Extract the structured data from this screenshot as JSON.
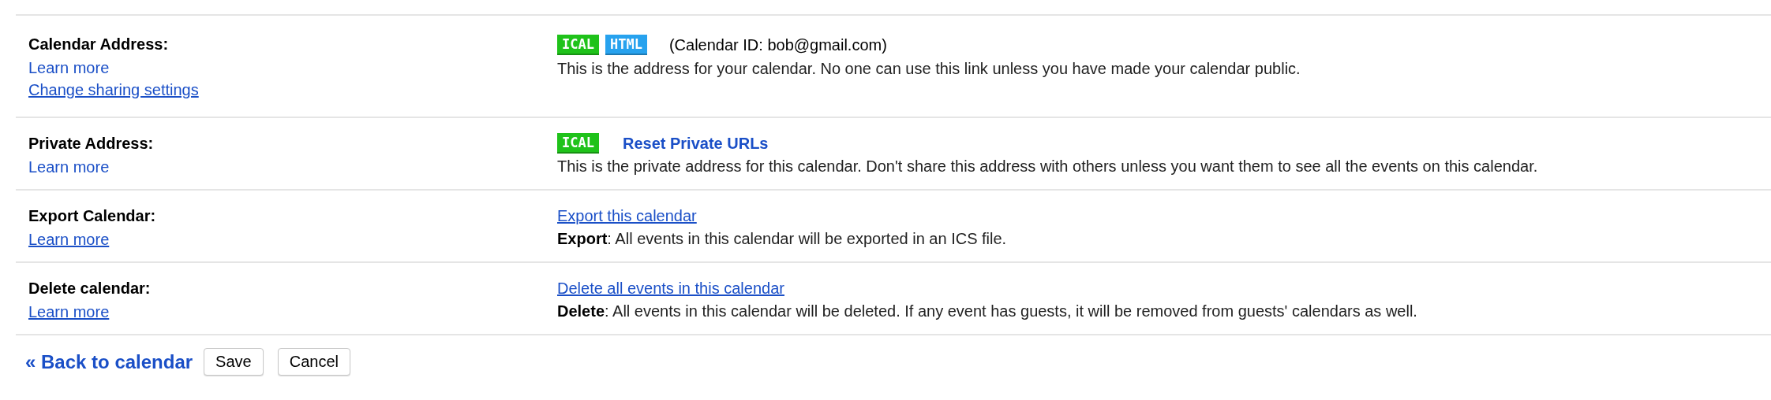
{
  "rows": [
    {
      "label": "Calendar Address:",
      "links": [
        {
          "text": "Learn more",
          "underlined": false
        },
        {
          "text": "Change sharing settings",
          "underlined": true
        }
      ],
      "controls": [
        {
          "kind": "badge",
          "text": "ICAL",
          "color": "#1fc21a"
        },
        {
          "kind": "badge",
          "text": "HTML",
          "color": "#27a2ee"
        },
        {
          "kind": "text",
          "text": "(Calendar ID: bob@gmail.com)"
        }
      ],
      "description": "This is the address for your calendar. No one can use this link unless you have made your calendar public."
    },
    {
      "label": "Private Address:",
      "links": [
        {
          "text": "Learn more",
          "underlined": false
        }
      ],
      "controls": [
        {
          "kind": "badge",
          "text": "ICAL",
          "color": "#1fc21a"
        },
        {
          "kind": "strong-link",
          "text": "Reset Private URLs",
          "underlined": false
        }
      ],
      "description": "This is the private address for this calendar. Don't share this address with others unless you want them to see all the events on this calendar."
    },
    {
      "label": "Export Calendar:",
      "links": [
        {
          "text": "Learn more",
          "underlined": true
        }
      ],
      "controls": [
        {
          "kind": "link",
          "text": "Export this calendar",
          "underlined": true
        }
      ],
      "description": "**Export**: All events in this calendar will be exported in an ICS file."
    },
    {
      "label": "Delete calendar:",
      "links": [
        {
          "text": "Learn more",
          "underlined": true
        }
      ],
      "controls": [
        {
          "kind": "link",
          "text": "Delete all events in this calendar",
          "underlined": true
        }
      ],
      "description": "**Delete**: All events in this calendar will be deleted. If any event has guests, it will be removed from guests' calendars as well."
    }
  ],
  "footer": {
    "back_link": "« Back to calendar",
    "buttons": [
      "Save",
      "Cancel"
    ]
  }
}
